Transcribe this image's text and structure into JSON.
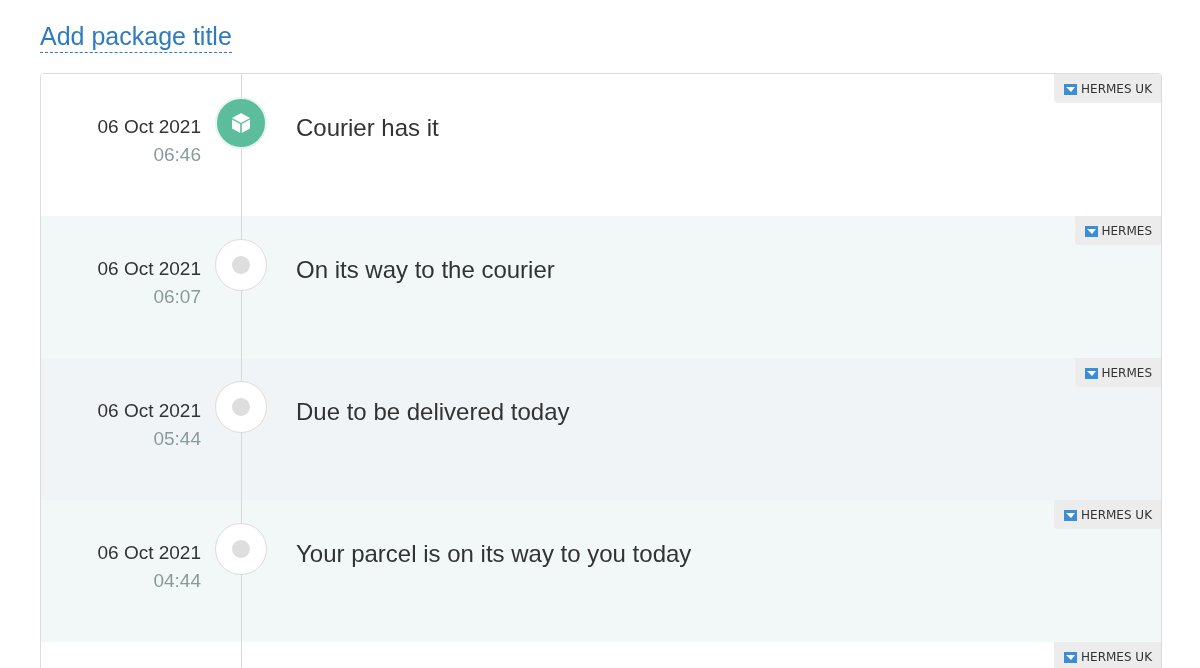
{
  "title_link": "Add package title",
  "events": [
    {
      "date": "06 Oct 2021",
      "time": "06:46",
      "text": "Courier has it",
      "carrier": "HERMES UK",
      "active": true
    },
    {
      "date": "06 Oct 2021",
      "time": "06:07",
      "text": "On its way to the courier",
      "carrier": "HERMES",
      "active": false
    },
    {
      "date": "06 Oct 2021",
      "time": "05:44",
      "text": "Due to be delivered today",
      "carrier": "HERMES",
      "active": false
    },
    {
      "date": "06 Oct 2021",
      "time": "04:44",
      "text": "Your parcel is on its way to you today",
      "carrier": "HERMES UK",
      "active": false
    },
    {
      "carrier": "HERMES UK"
    }
  ]
}
